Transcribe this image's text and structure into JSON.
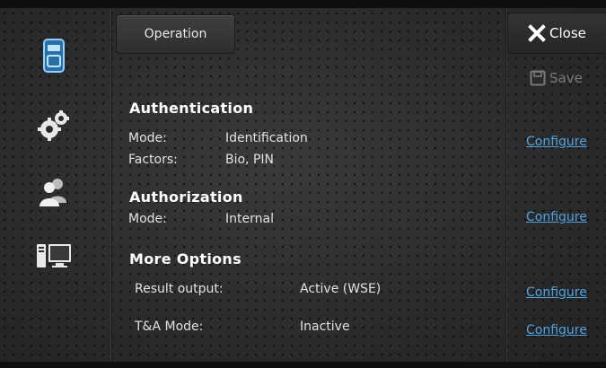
{
  "tab": {
    "label": "Operation"
  },
  "actions": {
    "close_label": "Close",
    "save_label": "Save",
    "configure_label": "Configure"
  },
  "sidebar": {
    "items": [
      "device-icon",
      "settings-gears-icon",
      "users-icon",
      "computer-monitor-icon"
    ]
  },
  "authentication": {
    "heading": "Authentication",
    "mode_label": "Mode:",
    "mode_value": "Identification",
    "factors_label": "Factors:",
    "factors_value": "Bio, PIN"
  },
  "authorization": {
    "heading": "Authorization",
    "mode_label": "Mode:",
    "mode_value": "Internal"
  },
  "more_options": {
    "heading": "More Options",
    "result_output_label": "Result output:",
    "result_output_value": "Active (WSE)",
    "ta_mode_label": "T&A Mode:",
    "ta_mode_value": "Inactive"
  },
  "colors": {
    "accent_blue": "#4fa3e0",
    "background": "#2b2b2b",
    "disabled": "#7a7a7a"
  }
}
